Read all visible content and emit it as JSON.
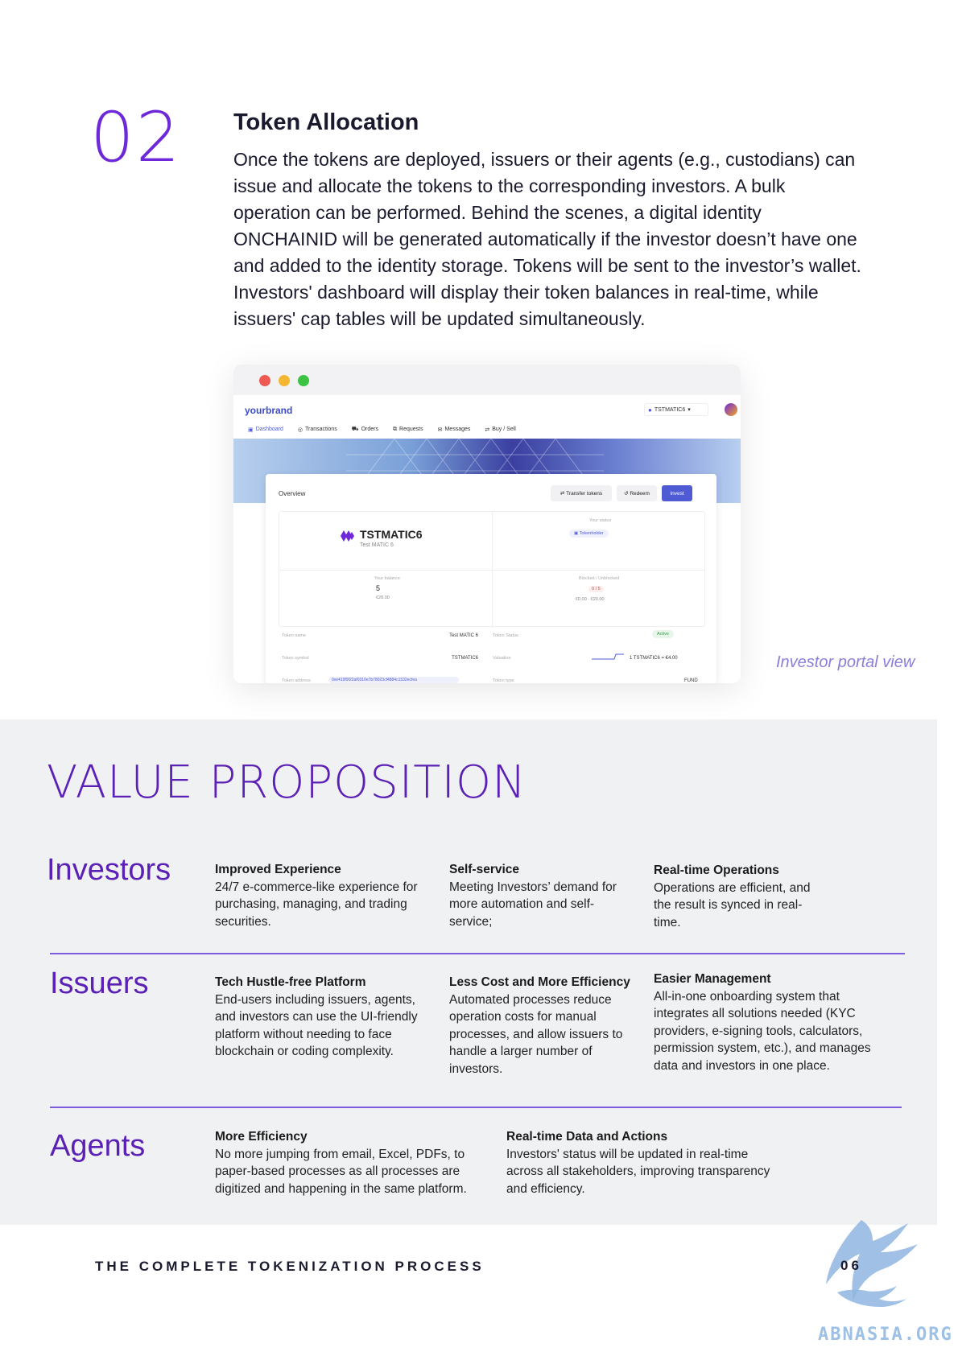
{
  "section": {
    "number": "02",
    "title": "Token Allocation",
    "body": "Once the tokens are deployed, issuers or their agents (e.g., custodians) can issue and allocate the tokens to the corresponding investors. A bulk operation can be performed. Behind the scenes, a digital identity ONCHAINID will be generated automatically if the investor doesn’t have one and added to the identity storage. Tokens will be sent to the investor’s wallet. Investors' dashboard will display their token balances in real-time, while issuers' cap tables will be updated simultaneously."
  },
  "mock": {
    "brand": "yourbrand",
    "account": "TSTMATIC6",
    "nav": [
      "Dashboard",
      "Transactions",
      "Orders",
      "Requests",
      "Messages",
      "Buy / Sell"
    ],
    "overview": "Overview",
    "buttons": {
      "transfer": "Transfer tokens",
      "redeem": "Redeem",
      "invest": "Invest"
    },
    "token_symbol_big": "TSTMATIC6",
    "token_name_small": "Test MATIC 6",
    "your_status_label": "Your status",
    "your_status_value": "Tokenholder",
    "balance_label": "Your balance",
    "balance_value": "5",
    "balance_eur": "€20.00",
    "blocked_label": "Blocked / Unblocked",
    "blocked_values": "0 / 5",
    "blocked_eur": "€0.00 · €20.00",
    "rows": [
      {
        "label": "Token name",
        "value": "Test MATIC 6",
        "label2": "Token Status",
        "value2": "Active"
      },
      {
        "label": "Token symbol",
        "value": "TSTMATIC6",
        "label2": "Valuation",
        "value2": "1 TSTMATIC6 = €4.00"
      },
      {
        "label": "Token address",
        "value": "0xe419f9f22af0310e7b78023cf4884c1532ecfea",
        "label2": "Token type",
        "value2": "FUND"
      }
    ]
  },
  "caption": "Investor portal view",
  "value_prop": {
    "title": "VALUE PROPOSITION",
    "groups": [
      {
        "role": "Investors",
        "items": [
          {
            "title": "Improved Experience",
            "text": "24/7 e-commerce-like experience for purchasing, managing, and trading securities."
          },
          {
            "title": "Self-service",
            "text": "Meeting Investors’ demand for more automation and self-service;"
          },
          {
            "title": "Real-time Operations",
            "text": "Operations are efficient, and the result is synced in real-time."
          }
        ]
      },
      {
        "role": "Issuers",
        "items": [
          {
            "title": "Tech Hustle-free Platform",
            "text": "End-users including issuers, agents, and investors can use the UI-friendly platform without needing to face blockchain or coding complexity."
          },
          {
            "title": "Less Cost and More Efficiency",
            "text": "Automated processes reduce operation costs for manual processes, and allow issuers to handle a larger number of investors."
          },
          {
            "title": "Easier Management",
            "text": "All-in-one onboarding system that integrates all solutions needed (KYC providers, e-signing tools, calculators, permission system, etc.), and manages data and investors in one place."
          }
        ]
      },
      {
        "role": "Agents",
        "items": [
          {
            "title": "More Efficiency",
            "text": "No more jumping from email, Excel, PDFs, to paper-based processes as all processes are digitized and happening in the same platform."
          },
          {
            "title": "Real-time Data and Actions",
            "text": "Investors' status will be updated in real-time across all stakeholders, improving transparency and efficiency."
          }
        ]
      }
    ]
  },
  "footer": {
    "label": "THE COMPLETE TOKENIZATION PROCESS",
    "page": "06"
  },
  "watermark": "ABNASIA.ORG",
  "colors": {
    "accent": "#6d28d9",
    "invest_button": "#4f5bd5",
    "panel_bg": "#f0f1f3"
  }
}
